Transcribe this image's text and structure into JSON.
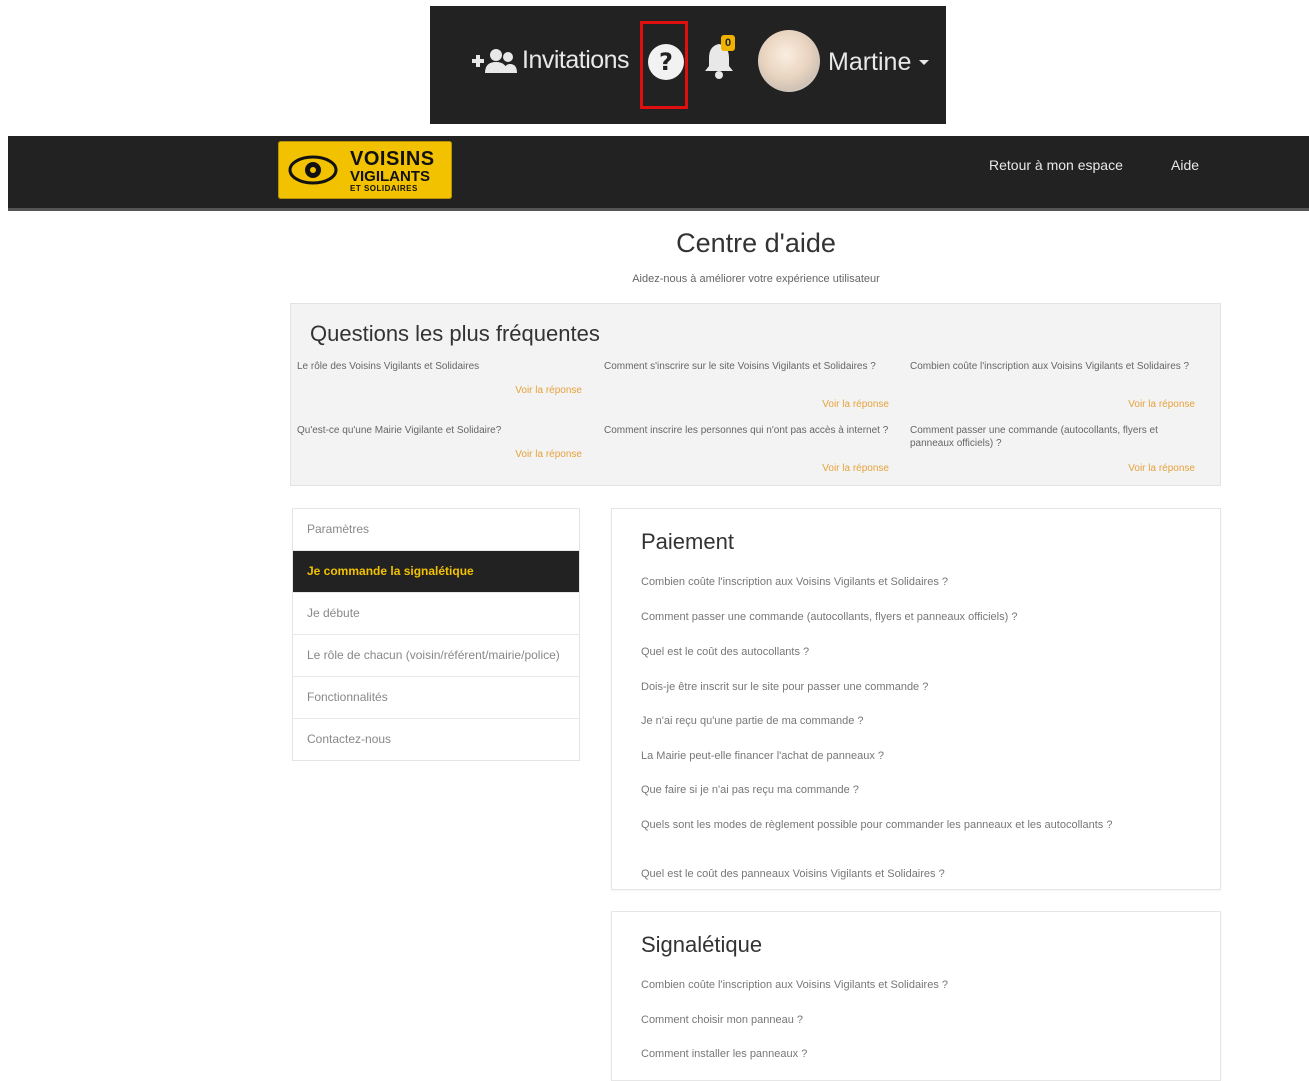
{
  "callout": {
    "invitations_label": "Invitations",
    "help_glyph": "?",
    "bell_badge": "0",
    "user_name": "Martine"
  },
  "navbar": {
    "logo_line1": "VOISINS",
    "logo_line2": "VIGILANTS",
    "logo_line3": "ET SOLIDAIRES",
    "back_link": "Retour à mon espace",
    "help_link": "Aide"
  },
  "page": {
    "title": "Centre d'aide",
    "subtitle": "Aidez-nous à améliorer votre expérience utilisateur"
  },
  "faq": {
    "title": "Questions les plus fréquentes",
    "more_label": "Voir la réponse",
    "items": [
      "Le rôle des Voisins Vigilants et Solidaires",
      "Comment s'inscrire sur le site Voisins Vigilants et Solidaires ?",
      "Combien coûte l'inscription aux Voisins Vigilants et Solidaires ?",
      "Qu'est-ce qu'une Mairie Vigilante et Solidaire?",
      "Comment inscrire les personnes qui n'ont pas accès à internet ?",
      "Comment passer une commande (autocollants, flyers et panneaux officiels) ?"
    ]
  },
  "sidebar": {
    "items": [
      "Paramètres",
      "Je commande la signalétique",
      "Je débute",
      "Le rôle de chacun (voisin/référent/mairie/police)",
      "Fonctionnalités",
      "Contactez-nous"
    ]
  },
  "payment": {
    "title": "Paiement",
    "questions": [
      "Combien coûte l'inscription aux Voisins Vigilants et Solidaires ?",
      "Comment passer une commande (autocollants, flyers et panneaux officiels) ?",
      "Quel est le coût des autocollants ?",
      "Dois-je être inscrit sur le site pour passer une commande ?",
      "Je n'ai reçu qu'une partie de ma commande ?",
      "La Mairie peut-elle financer l'achat de panneaux ?",
      "Que faire si je n'ai pas reçu ma commande ?",
      "Quels sont les modes de règlement possible pour commander les panneaux et les autocollants ?",
      "Quel est le coût des panneaux Voisins Vigilants et Solidaires ?"
    ]
  },
  "signage": {
    "title": "Signalétique",
    "questions": [
      "Combien coûte l'inscription aux Voisins Vigilants et Solidaires ?",
      "Comment choisir mon panneau ?",
      "Comment installer les panneaux ?"
    ]
  }
}
